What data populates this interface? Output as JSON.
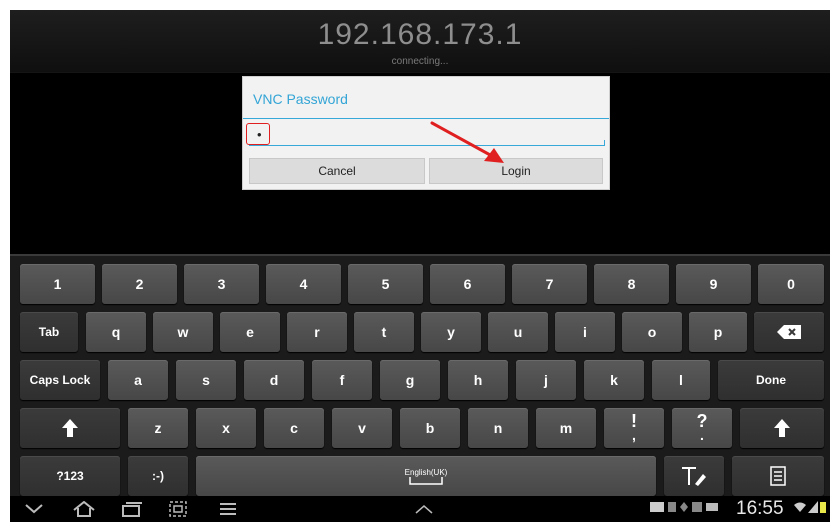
{
  "connection": {
    "host": "192.168.173.1",
    "status": "connecting..."
  },
  "dialog": {
    "title": "VNC Password",
    "password_value": "•",
    "cancel_label": "Cancel",
    "login_label": "Login"
  },
  "keyboard": {
    "row1": [
      "1",
      "2",
      "3",
      "4",
      "5",
      "6",
      "7",
      "8",
      "9",
      "0"
    ],
    "row2": {
      "tab": "Tab",
      "letters": [
        "q",
        "w",
        "e",
        "r",
        "t",
        "y",
        "u",
        "i",
        "o",
        "p"
      ],
      "backspace_icon": "backspace-icon"
    },
    "row3": {
      "caps": "Caps Lock",
      "letters": [
        "a",
        "s",
        "d",
        "f",
        "g",
        "h",
        "j",
        "k",
        "l"
      ],
      "done": "Done"
    },
    "row4": {
      "shift_icon": "shift-icon",
      "letters": [
        "z",
        "x",
        "c",
        "v",
        "b",
        "n",
        "m"
      ],
      "punct1_top": "!",
      "punct1_bottom": ",",
      "punct2_top": "?",
      "punct2_bottom": "."
    },
    "row5": {
      "symbols": "?123",
      "emoticon": ":-)",
      "space_label": "English(UK)",
      "handwriting_icon": "handwriting-icon",
      "clipboard_icon": "clipboard-icon"
    }
  },
  "system_bar": {
    "time": "16:55",
    "icons": [
      "back-icon",
      "home-icon",
      "recent-apps-icon",
      "screenshot-icon",
      "menu-icon",
      "up-arrow-icon",
      "keyboard-icon",
      "wifi-icon",
      "signal-icon",
      "battery-icon"
    ]
  },
  "colors": {
    "accent": "#33a5d6",
    "annotation": "#e02020",
    "background": "#000000",
    "key": "#4f4f4f"
  }
}
